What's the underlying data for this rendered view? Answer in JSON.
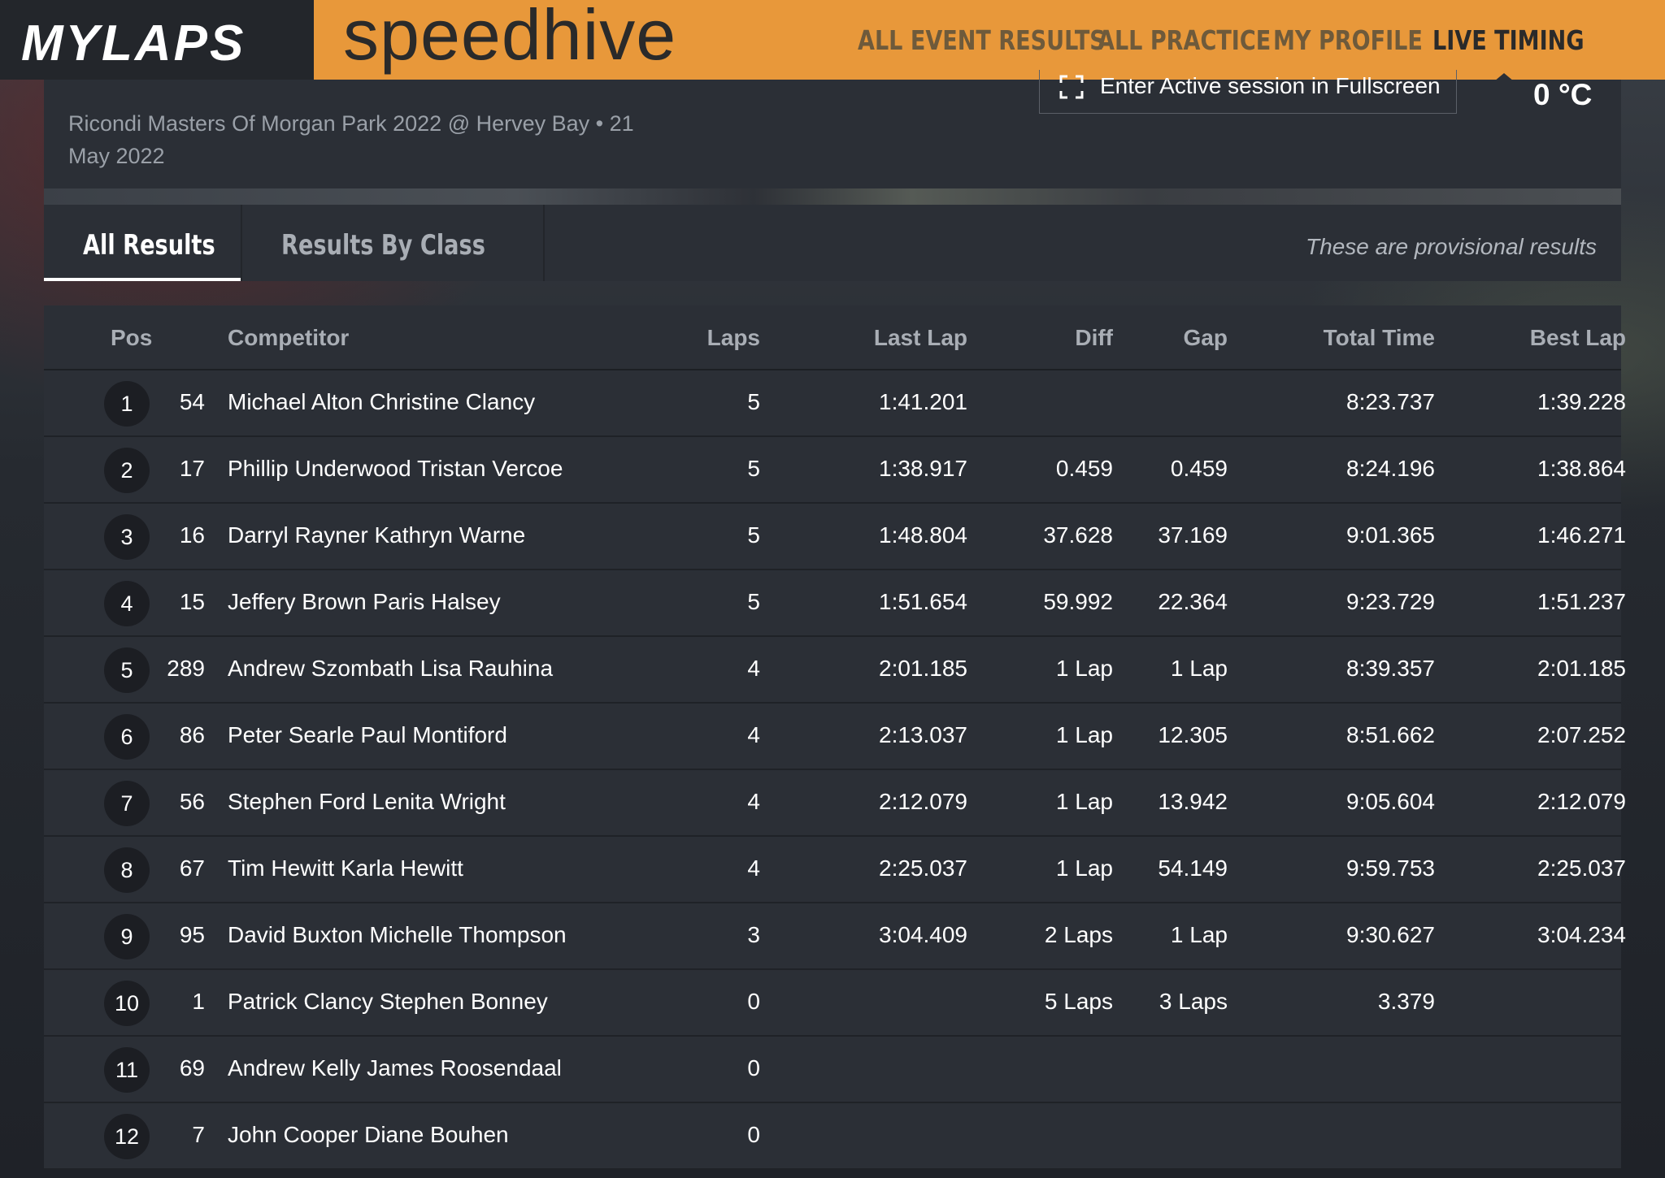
{
  "header": {
    "brand": "MYLAPS",
    "product": "speedhive",
    "nav": [
      {
        "label": "ALL EVENT RESULTS",
        "active": false
      },
      {
        "label": "ALL PRACTICE",
        "active": false
      },
      {
        "label": "MY PROFILE",
        "active": false
      },
      {
        "label": "LIVE TIMING",
        "active": true
      }
    ],
    "accent_color": "#e8983a"
  },
  "event": {
    "subtitle": "Ricondi Masters Of Morgan Park 2022 @ Hervey Bay • 21 May 2022",
    "fullscreen_label": "Enter Active session in Fullscreen",
    "temperature": "0 °C"
  },
  "tabs": {
    "all_results": "All Results",
    "results_by_class": "Results By Class",
    "active": "All Results",
    "notice": "These are provisional results"
  },
  "table": {
    "headers": {
      "pos": "Pos",
      "competitor": "Competitor",
      "laps": "Laps",
      "last_lap": "Last Lap",
      "diff": "Diff",
      "gap": "Gap",
      "total_time": "Total Time",
      "best_lap": "Best Lap"
    },
    "rows": [
      {
        "pos": "1",
        "num": "54",
        "competitor": "Michael Alton Christine Clancy",
        "laps": "5",
        "last_lap": "1:41.201",
        "diff": "",
        "gap": "",
        "total_time": "8:23.737",
        "best_lap": "1:39.228"
      },
      {
        "pos": "2",
        "num": "17",
        "competitor": "Phillip Underwood Tristan Vercoe",
        "laps": "5",
        "last_lap": "1:38.917",
        "diff": "0.459",
        "gap": "0.459",
        "total_time": "8:24.196",
        "best_lap": "1:38.864"
      },
      {
        "pos": "3",
        "num": "16",
        "competitor": "Darryl Rayner Kathryn Warne",
        "laps": "5",
        "last_lap": "1:48.804",
        "diff": "37.628",
        "gap": "37.169",
        "total_time": "9:01.365",
        "best_lap": "1:46.271"
      },
      {
        "pos": "4",
        "num": "15",
        "competitor": "Jeffery Brown Paris Halsey",
        "laps": "5",
        "last_lap": "1:51.654",
        "diff": "59.992",
        "gap": "22.364",
        "total_time": "9:23.729",
        "best_lap": "1:51.237"
      },
      {
        "pos": "5",
        "num": "289",
        "competitor": "Andrew Szombath Lisa Rauhina",
        "laps": "4",
        "last_lap": "2:01.185",
        "diff": "1 Lap",
        "gap": "1 Lap",
        "total_time": "8:39.357",
        "best_lap": "2:01.185"
      },
      {
        "pos": "6",
        "num": "86",
        "competitor": "Peter Searle Paul Montiford",
        "laps": "4",
        "last_lap": "2:13.037",
        "diff": "1 Lap",
        "gap": "12.305",
        "total_time": "8:51.662",
        "best_lap": "2:07.252"
      },
      {
        "pos": "7",
        "num": "56",
        "competitor": "Stephen Ford Lenita Wright",
        "laps": "4",
        "last_lap": "2:12.079",
        "diff": "1 Lap",
        "gap": "13.942",
        "total_time": "9:05.604",
        "best_lap": "2:12.079"
      },
      {
        "pos": "8",
        "num": "67",
        "competitor": "Tim Hewitt Karla Hewitt",
        "laps": "4",
        "last_lap": "2:25.037",
        "diff": "1 Lap",
        "gap": "54.149",
        "total_time": "9:59.753",
        "best_lap": "2:25.037"
      },
      {
        "pos": "9",
        "num": "95",
        "competitor": "David Buxton Michelle Thompson",
        "laps": "3",
        "last_lap": "3:04.409",
        "diff": "2 Laps",
        "gap": "1 Lap",
        "total_time": "9:30.627",
        "best_lap": "3:04.234"
      },
      {
        "pos": "10",
        "num": "1",
        "competitor": "Patrick Clancy Stephen Bonney",
        "laps": "0",
        "last_lap": "",
        "diff": "5 Laps",
        "gap": "3 Laps",
        "total_time": "3.379",
        "best_lap": ""
      },
      {
        "pos": "11",
        "num": "69",
        "competitor": "Andrew Kelly James Roosendaal",
        "laps": "0",
        "last_lap": "",
        "diff": "",
        "gap": "",
        "total_time": "",
        "best_lap": ""
      },
      {
        "pos": "12",
        "num": "7",
        "competitor": "John Cooper Diane Bouhen",
        "laps": "0",
        "last_lap": "",
        "diff": "",
        "gap": "",
        "total_time": "",
        "best_lap": ""
      }
    ]
  }
}
